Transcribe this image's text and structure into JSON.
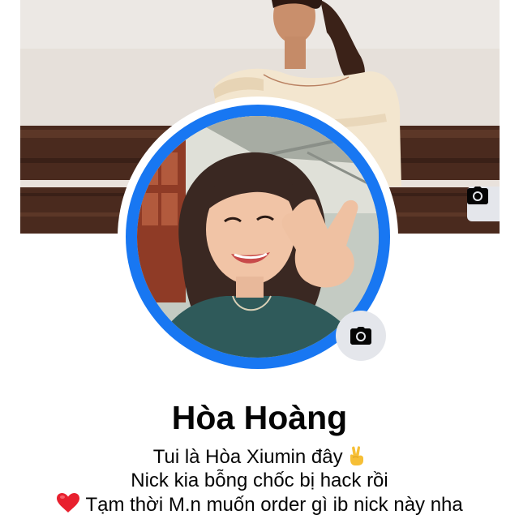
{
  "profile": {
    "name": "Hòa Hoàng",
    "bio": {
      "line1": "Tui là Hòa Xiumin đây",
      "line1_emoji": "victory-hand-icon",
      "line2": "Nick kia bỗng chốc bị hack rồi",
      "line3_emoji": "red-heart-icon",
      "line3": "Tạm thời M.n muốn order gì ib nick này nha"
    }
  },
  "icons": {
    "cover_camera": "camera-icon",
    "avatar_camera": "camera-icon"
  },
  "colors": {
    "avatar_ring": "#1877f2",
    "camera_button_bg": "#e4e6eb",
    "text": "#050505",
    "heart": "#e8202e"
  }
}
